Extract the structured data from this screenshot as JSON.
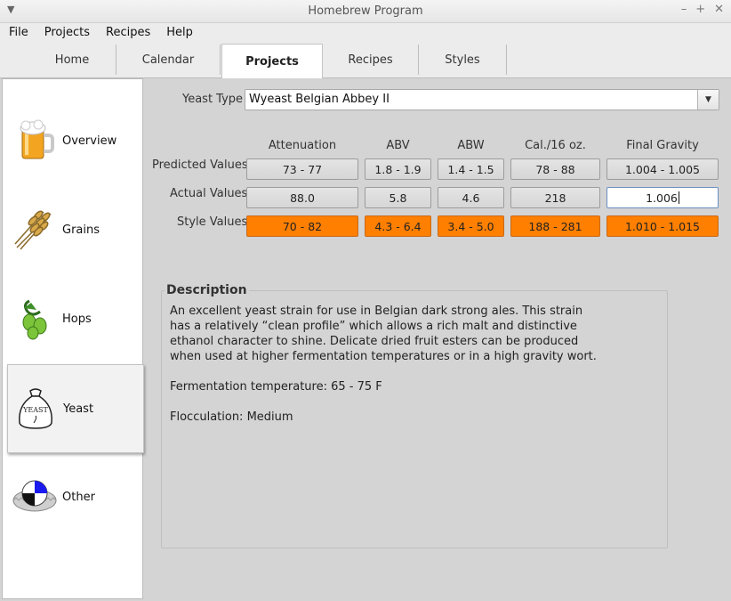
{
  "window": {
    "title": "Homebrew Program"
  },
  "menu": [
    "File",
    "Projects",
    "Recipes",
    "Help"
  ],
  "tabs": [
    {
      "label": "Home"
    },
    {
      "label": "Calendar"
    },
    {
      "label": "Projects",
      "active": true
    },
    {
      "label": "Recipes"
    },
    {
      "label": "Styles"
    }
  ],
  "sidebar": [
    {
      "label": "Overview",
      "icon": "beer-mug-icon"
    },
    {
      "label": "Grains",
      "icon": "wheat-icon"
    },
    {
      "label": "Hops",
      "icon": "hops-icon"
    },
    {
      "label": "Yeast",
      "icon": "yeast-bag-icon",
      "selected": true
    },
    {
      "label": "Other",
      "icon": "bottle-cap-icon"
    }
  ],
  "yeast": {
    "label": "Yeast Type",
    "value": "Wyeast Belgian Abbey II"
  },
  "table": {
    "columns": [
      "Attenuation",
      "ABV",
      "ABW",
      "Cal./16 oz.",
      "Final Gravity"
    ],
    "rows": [
      {
        "label": "Predicted Values",
        "values": [
          "73 - 77",
          "1.8 - 1.9",
          "1.4 - 1.5",
          "78 - 88",
          "1.004 - 1.005"
        ]
      },
      {
        "label": "Actual Values",
        "values": [
          "88.0",
          "5.8",
          "4.6",
          "218",
          "1.006"
        ]
      },
      {
        "label": "Style Values",
        "values": [
          "70 - 82",
          "4.3 - 6.4",
          "3.4 - 5.0",
          "188 - 281",
          "1.010 - 1.015"
        ]
      }
    ]
  },
  "description": {
    "title": "Description",
    "paragraphs": [
      "An excellent yeast strain for use in Belgian dark strong ales. This strain has a relatively “clean profile” which allows a rich malt and distinctive ethanol character to shine. Delicate dried fruit esters can be produced when used at higher fermentation temperatures or in a high gravity wort.",
      "Fermentation temperature: 65 - 75 F",
      "Flocculation: Medium"
    ]
  },
  "colors": {
    "style_highlight": "#ff7f00",
    "panel_bg": "#d4d4d4"
  }
}
